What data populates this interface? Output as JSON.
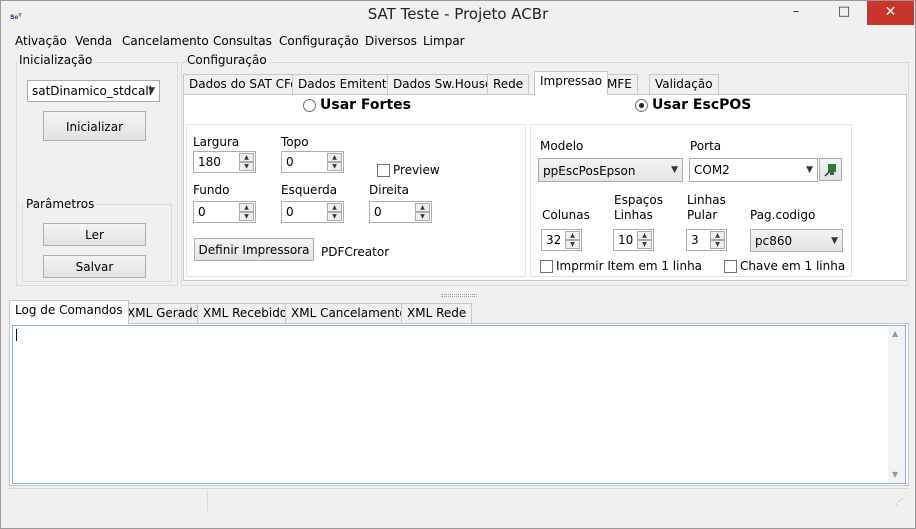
{
  "window": {
    "title": "SAT Teste - Projeto ACBr",
    "icon": "acbr-app-icon",
    "minimize": "–",
    "maximize": "□",
    "close": "✕"
  },
  "menu": [
    "Ativação",
    "Venda",
    "Cancelamento",
    "Consultas",
    "Configuração",
    "Diversos",
    "Limpar"
  ],
  "left": {
    "init_group": "Inicialização",
    "lib_select": "satDinamico_stdcall",
    "init_button": "Inicializar",
    "params_group": "Parâmetros",
    "read_button": "Ler",
    "save_button": "Salvar"
  },
  "config": {
    "group": "Configuração",
    "tabs": [
      "Dados do SAT CFe",
      "Dados Emitente",
      "Dados Sw.House",
      "Rede",
      "Impressao",
      "MFE",
      "Validação"
    ],
    "active_tab": "Impressao"
  },
  "impressao": {
    "radio_fortes": "Usar Fortes",
    "radio_escpos": "Usar EscPOS",
    "selected": "Usar EscPOS",
    "fortes": {
      "largura_label": "Largura",
      "largura": "180",
      "topo_label": "Topo",
      "topo": "0",
      "preview_label": "Preview",
      "preview_checked": false,
      "fundo_label": "Fundo",
      "fundo": "0",
      "esquerda_label": "Esquerda",
      "esquerda": "0",
      "direita_label": "Direita",
      "direita": "0",
      "printer_button": "Definir Impressora",
      "printer_name": "PDFCreator"
    },
    "escpos": {
      "modelo_label": "Modelo",
      "modelo": "ppEscPosEpson",
      "porta_label": "Porta",
      "porta": "COM2",
      "colunas_label": "Colunas",
      "colunas": "32",
      "espacos_label_1": "Espaços",
      "espacos_label_2": "Linhas",
      "espacos": "10",
      "linhas_label_1": "Linhas",
      "linhas_label_2": "Pular",
      "linhas": "3",
      "pagcodigo_label": "Pag.codigo",
      "pagcodigo": "pc860",
      "imprimir_item_label": "Imprmir Item em 1 linha",
      "imprimir_item_checked": false,
      "chave_label": "Chave em 1 linha",
      "chave_checked": false
    }
  },
  "bottom_tabs": [
    "Log de Comandos",
    "XML Gerado",
    "XML Recebido",
    "XML Cancelamento",
    "XML Rede"
  ],
  "bottom_active": "Log de Comandos",
  "log_text": "",
  "colors": {
    "close": "#c7352c",
    "face": "#f0f0f0",
    "border": "#c8c8c8"
  }
}
